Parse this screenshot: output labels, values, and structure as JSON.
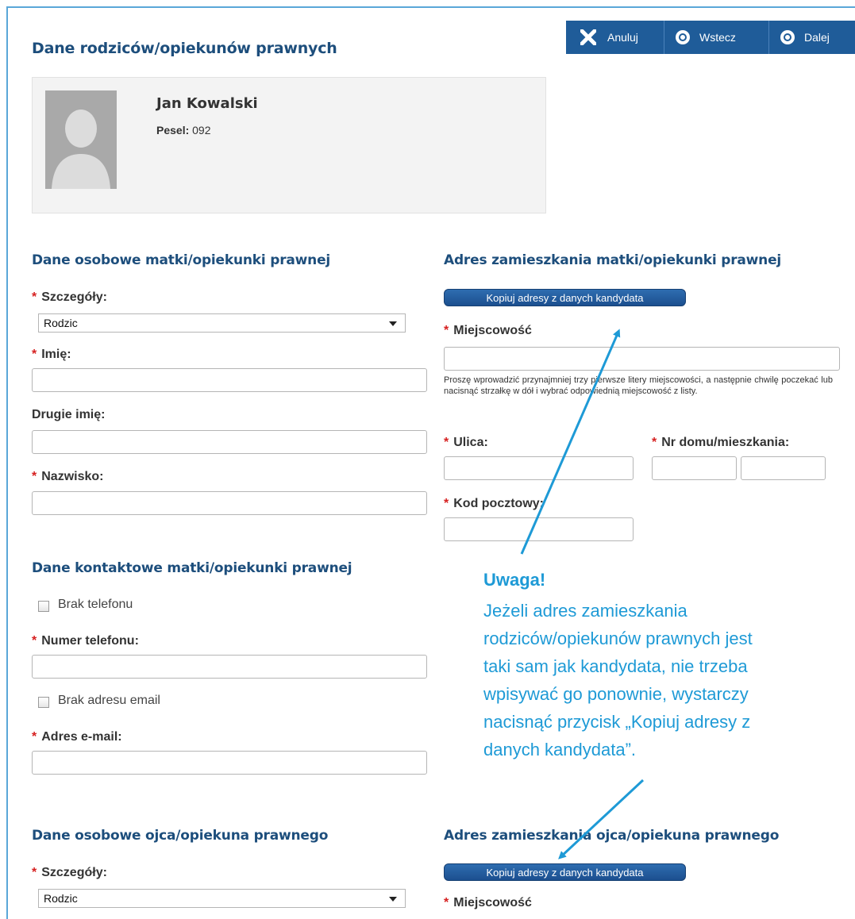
{
  "page": {
    "title": "Dane rodziców/opiekunów prawnych"
  },
  "toolbar": {
    "cancel_label": "Anuluj",
    "back_label": "Wstecz",
    "next_label": "Dalej"
  },
  "profile": {
    "name": "Jan Kowalski",
    "pesel_label": "Pesel:",
    "pesel_value": "092"
  },
  "mother": {
    "personal_heading": "Dane osobowe matki/opiekunki prawnej",
    "details_label": "Szczegóły:",
    "details_value": "Rodzic",
    "first_name_label": "Imię:",
    "second_name_label": "Drugie imię:",
    "surname_label": "Nazwisko:",
    "address_heading": "Adres zamieszkania matki/opiekunki prawnej",
    "copy_button": "Kopiuj adresy z danych kandydata",
    "city_label": "Miejscowość",
    "city_hint": "Proszę wprowadzić przynajmniej trzy pierwsze litery miejscowości, a następnie chwilę poczekać lub nacisnąć strzałkę w dół i wybrać odpowiednią miejscowość z listy.",
    "street_label": "Ulica:",
    "house_label": "Nr domu/mieszkania:",
    "postal_label": "Kod pocztowy:",
    "contact_heading": "Dane kontaktowe matki/opiekunki prawnej",
    "no_phone_label": "Brak telefonu",
    "phone_label": "Numer telefonu:",
    "no_email_label": "Brak adresu email",
    "email_label": "Adres e-mail:"
  },
  "father": {
    "personal_heading": "Dane osobowe ojca/opiekuna prawnego",
    "details_label": "Szczegóły:",
    "details_value": "Rodzic",
    "address_heading": "Adres zamieszkania ojca/opiekuna prawnego",
    "copy_button": "Kopiuj adresy z danych kandydata",
    "city_label": "Miejscowość"
  },
  "note": {
    "title": "Uwaga!",
    "lines": [
      "Jeżeli adres zamieszkania",
      "rodziców/opiekunów prawnych jest",
      "taki sam jak kandydata, nie trzeba",
      "wpisywać go ponownie, wystarczy",
      "nacisnąć przycisk „Kopiuj adresy z",
      "danych kandydata”."
    ]
  },
  "colors": {
    "accent": "#1d4e7c",
    "toolbar": "#1f5c99",
    "note": "#1e9ad6",
    "required": "#d62020"
  }
}
